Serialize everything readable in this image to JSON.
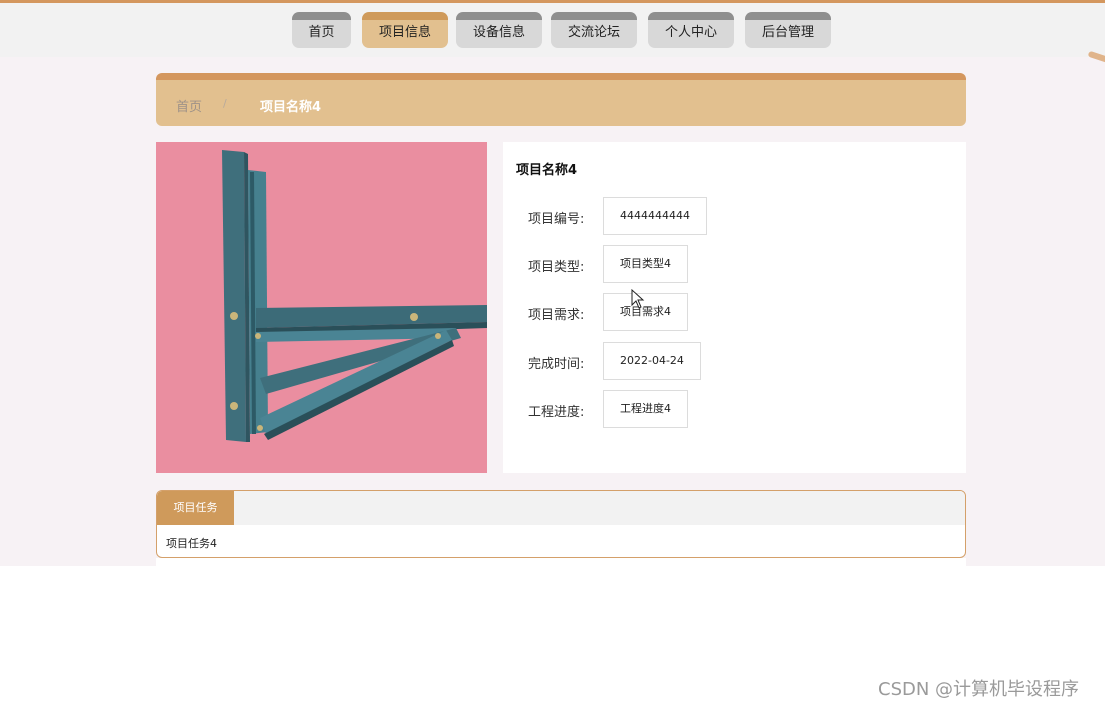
{
  "nav": {
    "items": [
      {
        "label": "首页",
        "active": false
      },
      {
        "label": "项目信息",
        "active": true
      },
      {
        "label": "设备信息",
        "active": false
      },
      {
        "label": "交流论坛",
        "active": false
      },
      {
        "label": "个人中心",
        "active": false
      },
      {
        "label": "后台管理",
        "active": false
      }
    ]
  },
  "breadcrumb": {
    "home": "首页",
    "separator": "/",
    "current": "项目名称4"
  },
  "detail": {
    "title": "项目名称4",
    "fields": [
      {
        "label": "项目编号:",
        "value": "4444444444"
      },
      {
        "label": "项目类型:",
        "value": "项目类型4"
      },
      {
        "label": "项目需求:",
        "value": "项目需求4"
      },
      {
        "label": "完成时间:",
        "value": "2022-04-24"
      },
      {
        "label": "工程进度:",
        "value": "工程进度4"
      }
    ]
  },
  "task": {
    "tab_label": "项目任务",
    "content": "项目任务4"
  },
  "watermark": "CSDN @计算机毕设程序",
  "colors": {
    "accent": "#cf9a5b",
    "accent_light": "#e2c08f",
    "nav_inactive": "#d8d8d8",
    "photo_background": "#e8899b",
    "steel": "#3f6f7c"
  }
}
